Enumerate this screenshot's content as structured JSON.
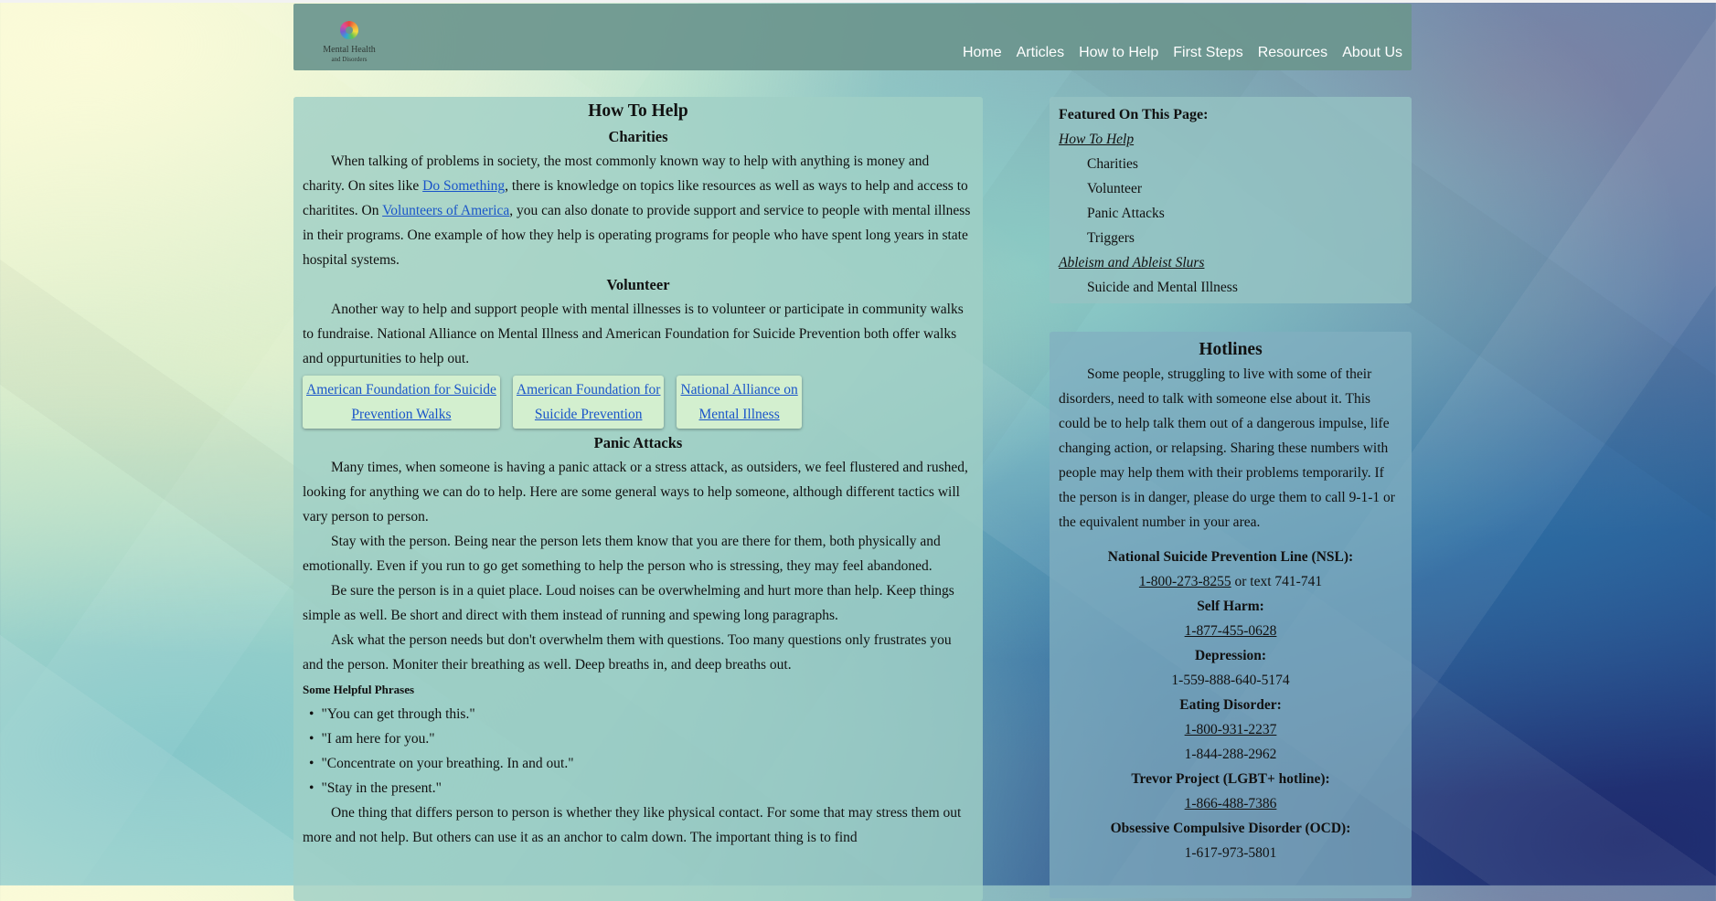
{
  "header": {
    "logo_line1": "Mental Health",
    "logo_line2": "and Disorders",
    "nav": [
      "Home",
      "Articles",
      "How to Help",
      "First Steps",
      "Resources",
      "About Us"
    ]
  },
  "main": {
    "title": "How To Help",
    "charities": {
      "heading": "Charities",
      "p1_a": "When talking of problems in society, the most commonly known way to help with anything is money and charity. On sites like ",
      "p1_link1": "Do Something",
      "p1_b": ", there is knowledge on topics like resources as well as ways to help and access to charitites. On ",
      "p1_link2": "Volunteers of America",
      "p1_c": ", you can also donate to provide support and service to people with mental illness in their programs. One example of how they help is operating programs for people who have spent long years in state hospital systems."
    },
    "volunteer": {
      "heading": "Volunteer",
      "p1": "Another way to help and support people with mental illnesses is to volunteer or participate in community walks to fundraise. National Alliance on Mental Illness and American Foundation for Suicide Prevention both offer walks and oppurtunities to help out.",
      "buttons": [
        {
          "l1": "American Foundation for Suicide",
          "l2": "Prevention Walks"
        },
        {
          "l1": "American Foundation for",
          "l2": "Suicide Prevention"
        },
        {
          "l1": "National Alliance on",
          "l2": "Mental Illness"
        }
      ]
    },
    "panic": {
      "heading": "Panic Attacks",
      "p1": "Many times, when someone is having a panic attack or a stress attack, as outsiders, we feel flustered and rushed, looking for anything we can do to help. Here are some general ways to help someone, although different tactics will vary person to person.",
      "p2": "Stay with the person. Being near the person lets them know that you are there for them, both physically and emotionally. Even if you run to go get something to help the person who is stressing, they may feel abandoned.",
      "p3": "Be sure the person is in a quiet place. Loud noises can be overwhelming and hurt more than help. Keep things simple as well. Be short and direct with them instead of running and spewing long paragraphs.",
      "p4": "Ask what the person needs but don't overwhelm them with questions. Too many questions only frustrates you and the person. Moniter their breathing as well. Deep breaths in, and deep breaths out.",
      "phrases_heading": "Some Helpful Phrases",
      "phrases": [
        "\"You can get through this.\"",
        "\"I am here for you.\"",
        "\"Concentrate on your breathing. In and out.\"",
        "\"Stay in the present.\""
      ],
      "p5": "One thing that differs person to person is whether they like physical contact. For some that may stress them out more and not help. But others can use it as an anchor to calm down. The important thing is to find"
    }
  },
  "featured": {
    "heading": "Featured On This Page:",
    "link1": "How To Help",
    "subs1": [
      "Charities",
      "Volunteer",
      "Panic Attacks",
      "Triggers"
    ],
    "link2": "Ableism and Ableist Slurs",
    "subs2": [
      "Suicide and Mental Illness"
    ]
  },
  "hotlines": {
    "heading": "Hotlines",
    "intro": "Some people, struggling to live with some of their disorders, need to talk with someone else about it. This could be to help talk them out of a dangerous impulse, life changing action, or relapsing. Sharing these numbers with people may help them with their problems temporarily. If the person is in danger, please do urge them to call 9-1-1 or the equivalent number in your area.",
    "nsl_label": "National Suicide Prevention Line (NSL):",
    "nsl_number": "1-800-273-8255",
    "nsl_text": " or text 741-741",
    "self_label": "Self Harm:",
    "self_number": "1-877-455-0628",
    "dep_label": "Depression:",
    "dep_number": "1-559-888-640-5174",
    "eat_label": "Eating Disorder:",
    "eat_number1": "1-800-931-2237",
    "eat_number2": "1-844-288-2962",
    "trev_label": "Trevor Project (LGBT+ hotline):",
    "trev_number": "1-866-488-7386",
    "ocd_label": "Obsessive Compulsive Disorder (OCD):",
    "ocd_number": "1-617-973-5801"
  }
}
